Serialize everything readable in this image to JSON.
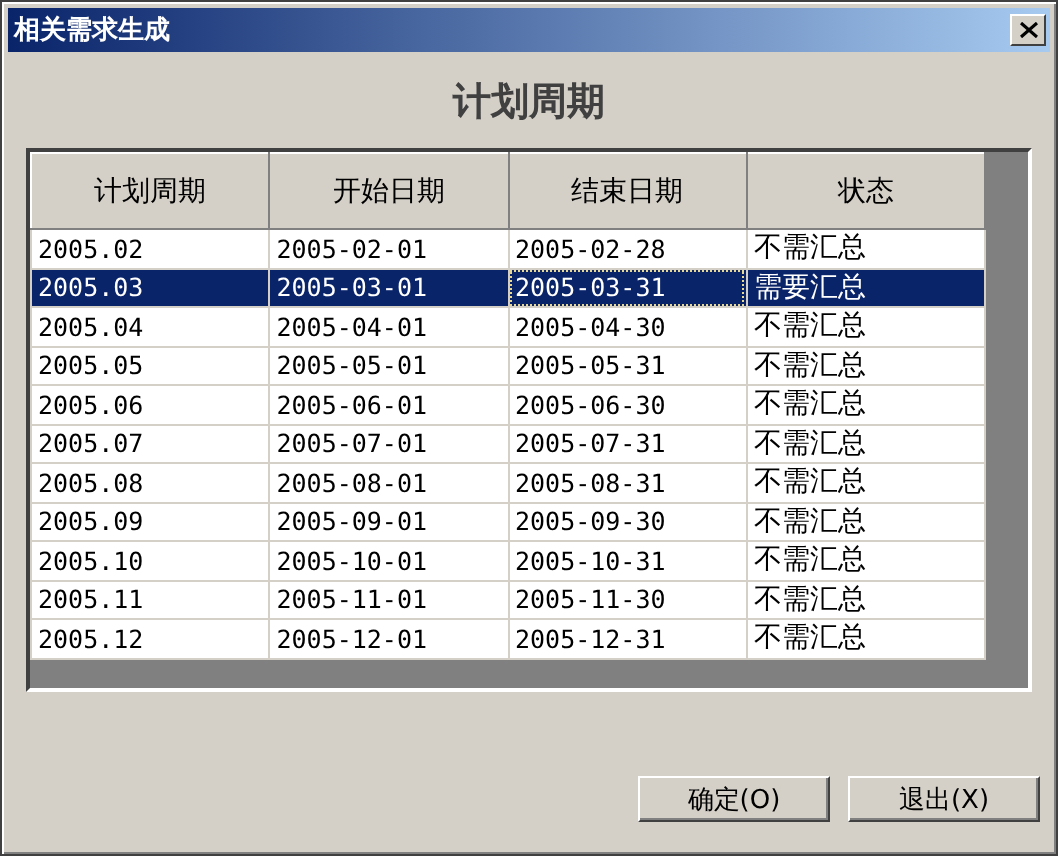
{
  "window": {
    "title": "相关需求生成"
  },
  "heading": "计划周期",
  "table": {
    "columns": [
      "计划周期",
      "开始日期",
      "结束日期",
      "状态"
    ],
    "rows": [
      {
        "cells": [
          "2005.02",
          "2005-02-01",
          "2005-02-28",
          "不需汇总"
        ],
        "selected": false
      },
      {
        "cells": [
          "2005.03",
          "2005-03-01",
          "2005-03-31",
          "需要汇总"
        ],
        "selected": true
      },
      {
        "cells": [
          "2005.04",
          "2005-04-01",
          "2005-04-30",
          "不需汇总"
        ],
        "selected": false
      },
      {
        "cells": [
          "2005.05",
          "2005-05-01",
          "2005-05-31",
          "不需汇总"
        ],
        "selected": false
      },
      {
        "cells": [
          "2005.06",
          "2005-06-01",
          "2005-06-30",
          "不需汇总"
        ],
        "selected": false
      },
      {
        "cells": [
          "2005.07",
          "2005-07-01",
          "2005-07-31",
          "不需汇总"
        ],
        "selected": false
      },
      {
        "cells": [
          "2005.08",
          "2005-08-01",
          "2005-08-31",
          "不需汇总"
        ],
        "selected": false
      },
      {
        "cells": [
          "2005.09",
          "2005-09-01",
          "2005-09-30",
          "不需汇总"
        ],
        "selected": false
      },
      {
        "cells": [
          "2005.10",
          "2005-10-01",
          "2005-10-31",
          "不需汇总"
        ],
        "selected": false
      },
      {
        "cells": [
          "2005.11",
          "2005-11-01",
          "2005-11-30",
          "不需汇总"
        ],
        "selected": false
      },
      {
        "cells": [
          "2005.12",
          "2005-12-01",
          "2005-12-31",
          "不需汇总"
        ],
        "selected": false
      }
    ]
  },
  "buttons": [
    "确定(O)",
    "退出(X)"
  ]
}
